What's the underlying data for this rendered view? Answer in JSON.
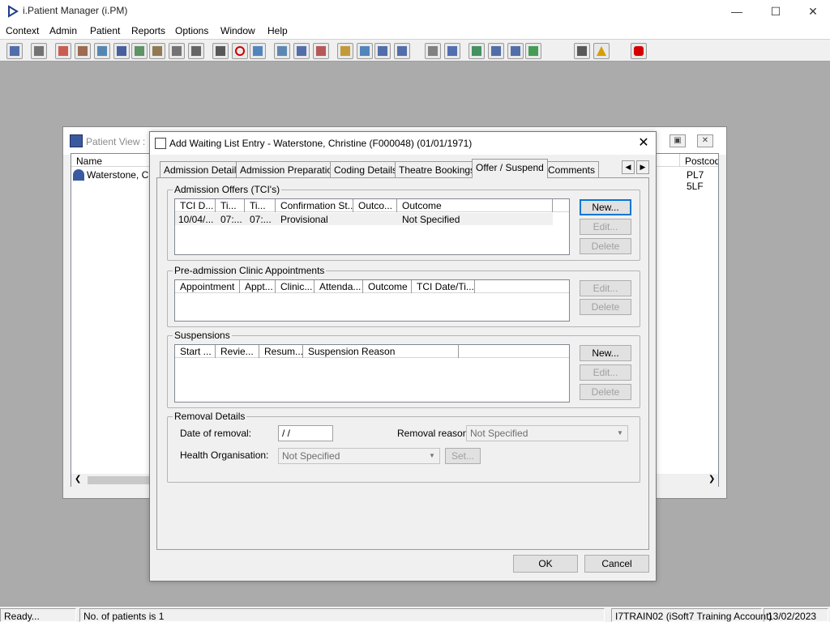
{
  "app": {
    "title": "i.Patient Manager (i.PM)",
    "window_controls": {
      "minimize": "—",
      "maximize": "☐",
      "close": "✕"
    }
  },
  "menu": [
    "Context",
    "Admin",
    "Patient",
    "Reports",
    "Options",
    "Window",
    "Help"
  ],
  "toolbar_icons": [
    "patient-icon",
    "printer-icon",
    "book-icon",
    "edit-doc-icon",
    "card-icon",
    "m-icon",
    "person-icon",
    "form-icon",
    "ticket-icon",
    "ticket2-icon",
    "search-doc-icon",
    "clock-icon",
    "monitor-icon",
    "list-icon",
    "chat-icon",
    "gauge-icon",
    "note-icon",
    "check-doc-icon",
    "printer2-icon",
    "tray-icon",
    "page-icon",
    "bar-chart-icon",
    "globe-icon",
    "flag-icon",
    "edit-check-icon",
    "green-check-icon",
    "arrows-icon",
    "warning-icon",
    "exit-icon"
  ],
  "patient_view": {
    "title": "Patient View :",
    "columns": {
      "name": "Name",
      "postcode": "Postcod"
    },
    "row": {
      "name": "Waterstone, Chri",
      "postcode": "PL7 5LF"
    }
  },
  "dialog": {
    "title": "Add Waiting List Entry - Waterstone, Christine (F000048) (01/01/1971)",
    "tabs": [
      "Admission Details",
      "Admission Preparation",
      "Coding Details",
      "Theatre Bookings",
      "Offer / Suspend",
      "Comments"
    ],
    "active_tab": "Offer / Suspend",
    "admission_offers": {
      "label": "Admission Offers (TCI's)",
      "columns": [
        "TCI D...",
        "Ti...",
        "Ti...",
        "Confirmation St...",
        "Outco...",
        "Outcome"
      ],
      "rows": [
        [
          "10/04/...",
          "07:...",
          "07:...",
          "Provisional",
          "",
          "Not Specified"
        ]
      ],
      "buttons": {
        "new": "New...",
        "edit": "Edit...",
        "delete": "Delete"
      }
    },
    "preadmission": {
      "label": "Pre-admission Clinic Appointments",
      "columns": [
        "Appointment",
        "Appt...",
        "Clinic...",
        "Attenda...",
        "Outcome",
        "TCI Date/Ti..."
      ],
      "buttons": {
        "edit": "Edit...",
        "delete": "Delete"
      }
    },
    "suspensions": {
      "label": "Suspensions",
      "columns": [
        "Start ...",
        "Revie...",
        "Resum...",
        "Suspension Reason"
      ],
      "buttons": {
        "new": "New...",
        "edit": "Edit...",
        "delete": "Delete"
      }
    },
    "removal": {
      "label": "Removal Details",
      "date_label": "Date of removal:",
      "date_value": " /  /",
      "reason_label": "Removal reason:",
      "reason_value": "Not Specified",
      "org_label": "Health Organisation:",
      "org_value": "Not Specified",
      "set_button": "Set..."
    },
    "ok": "OK",
    "cancel": "Cancel"
  },
  "status": {
    "ready": "Ready...",
    "patients": "No. of patients is 1",
    "account": "I7TRAIN02 (iSoft7 Training Account)",
    "date": "13/02/2023"
  },
  "colors": {
    "exit": "#d40000",
    "accent": "#0078d7"
  }
}
